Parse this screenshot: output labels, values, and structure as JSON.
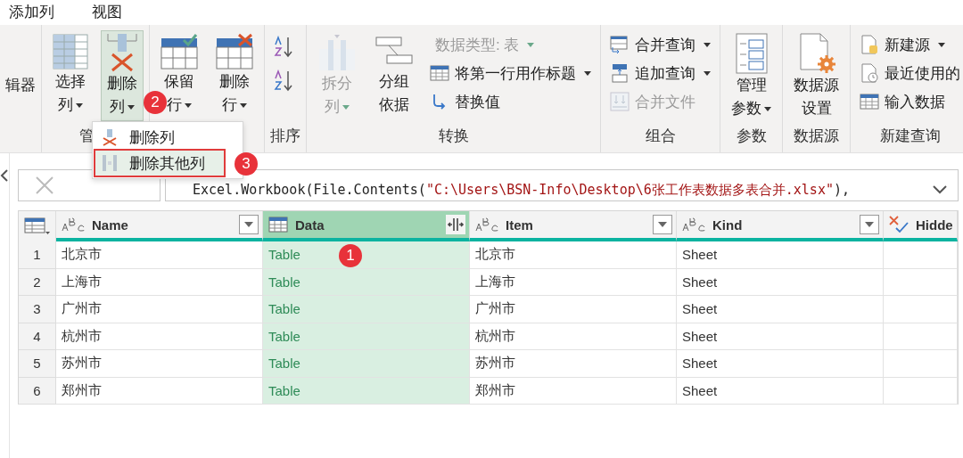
{
  "menu_tabs": [
    {
      "label": "添加列",
      "selected": false
    },
    {
      "label": "视图",
      "selected": false
    }
  ],
  "ribbon": {
    "groups": [
      {
        "items": [
          {
            "kind": "large",
            "lines": [
              "辑器"
            ],
            "disabled": false,
            "has_menu": false,
            "selected": false
          }
        ]
      },
      {
        "label": "管",
        "items": [
          {
            "kind": "large",
            "lines": [
              "选择",
              "列"
            ],
            "disabled": false,
            "has_menu": true,
            "selected": false
          },
          {
            "kind": "large",
            "lines": [
              "删除",
              "列"
            ],
            "disabled": false,
            "has_menu": true,
            "selected": true,
            "badge": "2"
          }
        ]
      },
      {
        "items": [
          {
            "kind": "large",
            "lines": [
              "保留",
              "行"
            ],
            "disabled": false,
            "has_menu": true,
            "selected": false
          },
          {
            "kind": "large",
            "lines": [
              "删除",
              "行"
            ],
            "disabled": false,
            "has_menu": true,
            "selected": false
          }
        ]
      },
      {
        "label": "排序",
        "items": [
          {
            "kind": "icon",
            "disabled": false
          },
          {
            "kind": "icon",
            "disabled": false
          }
        ]
      },
      {
        "label": "转换",
        "items": [
          {
            "kind": "large",
            "lines": [
              "拆分",
              "列"
            ],
            "disabled": true,
            "has_menu": true,
            "selected": false
          },
          {
            "kind": "large",
            "lines": [
              "分组",
              "依据"
            ],
            "disabled": false,
            "has_menu": false,
            "selected": false
          },
          {
            "kind": "small",
            "label": "数据类型: 表",
            "disabled": true,
            "has_menu": true
          },
          {
            "kind": "small",
            "label": "将第一行用作标题",
            "disabled": false,
            "has_menu": true
          },
          {
            "kind": "small",
            "label": "替换值",
            "disabled": false,
            "has_menu": false
          }
        ]
      },
      {
        "label": "组合",
        "items": [
          {
            "kind": "small",
            "label": "合并查询",
            "disabled": false,
            "has_menu": true
          },
          {
            "kind": "small",
            "label": "追加查询",
            "disabled": false,
            "has_menu": true
          },
          {
            "kind": "small",
            "label": "合并文件",
            "disabled": true,
            "has_menu": false
          }
        ]
      },
      {
        "label": "参数",
        "items": [
          {
            "kind": "large",
            "lines": [
              "管理",
              "参数"
            ],
            "disabled": false,
            "has_menu": true,
            "selected": false
          }
        ]
      },
      {
        "label": "数据源",
        "items": [
          {
            "kind": "large",
            "lines": [
              "数据源",
              "设置"
            ],
            "disabled": false,
            "has_menu": false,
            "selected": false
          }
        ]
      },
      {
        "label": "新建查询",
        "items": [
          {
            "kind": "small",
            "label": "新建源",
            "disabled": false,
            "has_menu": true
          },
          {
            "kind": "small",
            "label": "最近使用的",
            "disabled": false,
            "has_menu": false
          },
          {
            "kind": "small",
            "label": "输入数据",
            "disabled": false,
            "has_menu": false
          }
        ]
      }
    ]
  },
  "dropdown": {
    "items": [
      {
        "label": "删除列",
        "selected": false
      },
      {
        "label": "删除其他列",
        "selected": true,
        "badge": "3"
      }
    ]
  },
  "formula_bar": {
    "segments": [
      {
        "kind": "code",
        "text": "Excel.Workbook(File.Contents("
      },
      {
        "kind": "string",
        "text": "\"C:\\Users\\BSN-Info\\Desktop\\6张工作表数据多表合并.xlsx\""
      },
      {
        "kind": "code",
        "text": "),"
      }
    ]
  },
  "table": {
    "columns": [
      {
        "name": "Name",
        "kind": "text",
        "selected": false
      },
      {
        "name": "Data",
        "kind": "table",
        "selected": true,
        "badge": "1"
      },
      {
        "name": "Item",
        "kind": "text",
        "selected": false
      },
      {
        "name": "Kind",
        "kind": "text",
        "selected": false
      },
      {
        "name": "Hidde",
        "kind": "logical",
        "selected": false
      }
    ],
    "rows": [
      {
        "number": "1",
        "cells": [
          "北京市",
          "Table",
          "北京市",
          "Sheet",
          ""
        ]
      },
      {
        "number": "2",
        "cells": [
          "上海市",
          "Table",
          "上海市",
          "Sheet",
          ""
        ]
      },
      {
        "number": "3",
        "cells": [
          "广州市",
          "Table",
          "广州市",
          "Sheet",
          ""
        ]
      },
      {
        "number": "4",
        "cells": [
          "杭州市",
          "Table",
          "杭州市",
          "Sheet",
          ""
        ]
      },
      {
        "number": "5",
        "cells": [
          "苏州市",
          "Table",
          "苏州市",
          "Sheet",
          ""
        ]
      },
      {
        "number": "6",
        "cells": [
          "郑州市",
          "Table",
          "郑州市",
          "Sheet",
          ""
        ]
      }
    ]
  }
}
